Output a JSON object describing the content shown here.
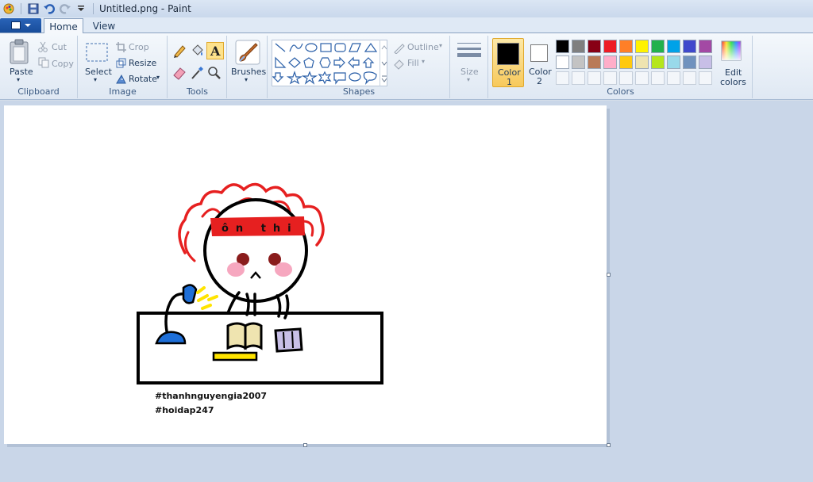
{
  "window": {
    "title": "Untitled.png - Paint"
  },
  "tabs": [
    {
      "label": "Home",
      "active": true
    },
    {
      "label": "View",
      "active": false
    }
  ],
  "ribbon": {
    "clipboard": {
      "group_label": "Clipboard",
      "paste": "Paste",
      "cut": "Cut",
      "copy": "Copy"
    },
    "image": {
      "group_label": "Image",
      "select": "Select",
      "crop": "Crop",
      "resize": "Resize",
      "rotate": "Rotate"
    },
    "tools": {
      "group_label": "Tools"
    },
    "brushes": {
      "label": "Brushes"
    },
    "shapes": {
      "group_label": "Shapes",
      "outline": "Outline",
      "fill": "Fill"
    },
    "size": {
      "label": "Size"
    },
    "colors": {
      "group_label": "Colors",
      "color1_label": "Color",
      "color1_num": "1",
      "color2_label": "Color",
      "color2_num": "2",
      "edit_colors_1": "Edit",
      "edit_colors_2": "colors",
      "color1_value": "#000000",
      "color2_value": "#ffffff",
      "palette_row1": [
        "#000000",
        "#7f7f7f",
        "#880015",
        "#ed1c24",
        "#ff7f27",
        "#fff200",
        "#22b14c",
        "#00a2e8",
        "#3f48cc",
        "#a349a4"
      ],
      "palette_row2": [
        "#ffffff",
        "#c3c3c3",
        "#b97a57",
        "#ffaec9",
        "#ffc90e",
        "#efe4b0",
        "#b5e61d",
        "#99d9ea",
        "#7092be",
        "#c8bfe7"
      ]
    }
  },
  "canvas": {
    "headband_text": "ôn thi",
    "hashtag1": "#thanhnguyengia2007",
    "hashtag2": "#hoidap247"
  }
}
